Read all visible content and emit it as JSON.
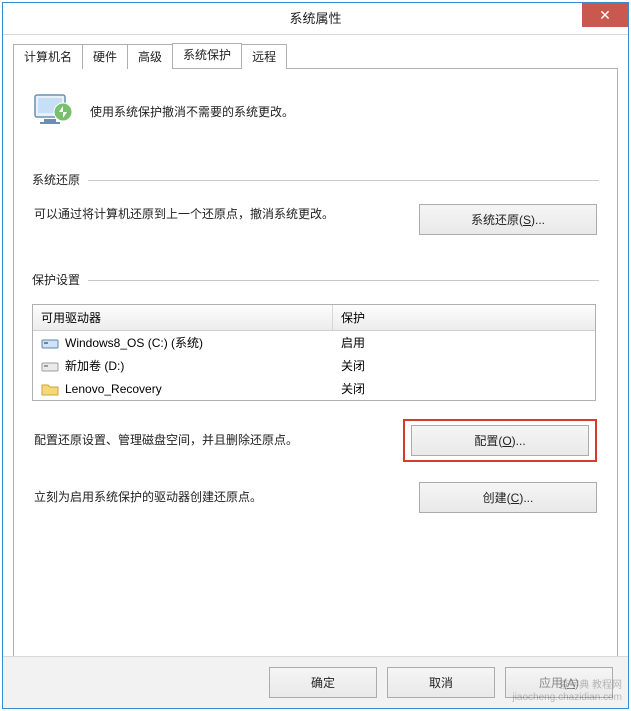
{
  "window": {
    "title": "系统属性"
  },
  "tabs": {
    "t0": "计算机名",
    "t1": "硬件",
    "t2": "高级",
    "t3": "系统保护",
    "t4": "远程"
  },
  "intro": {
    "text": "使用系统保护撤消不需要的系统更改。"
  },
  "restore": {
    "section_label": "系统还原",
    "desc": "可以通过将计算机还原到上一个还原点，撤消系统更改。",
    "button": "系统还原(S)..."
  },
  "protect": {
    "section_label": "保护设置",
    "col_drive": "可用驱动器",
    "col_status": "保护",
    "rows": [
      {
        "name": "Windows8_OS (C:) (系统)",
        "status": "启用",
        "icon": "drive"
      },
      {
        "name": "新加卷 (D:)",
        "status": "关闭",
        "icon": "drive"
      },
      {
        "name": "Lenovo_Recovery",
        "status": "关闭",
        "icon": "folder"
      }
    ]
  },
  "config": {
    "desc": "配置还原设置、管理磁盘空间，并且删除还原点。",
    "button": "配置(O)..."
  },
  "create": {
    "desc": "立刻为启用系统保护的驱动器创建还原点。",
    "button": "创建(C)..."
  },
  "buttons": {
    "ok": "确定",
    "cancel": "取消",
    "apply": "应用(A)"
  },
  "watermark": {
    "l1": "查字典 教程网",
    "l2": "jiaocheng.chazidian.com"
  }
}
